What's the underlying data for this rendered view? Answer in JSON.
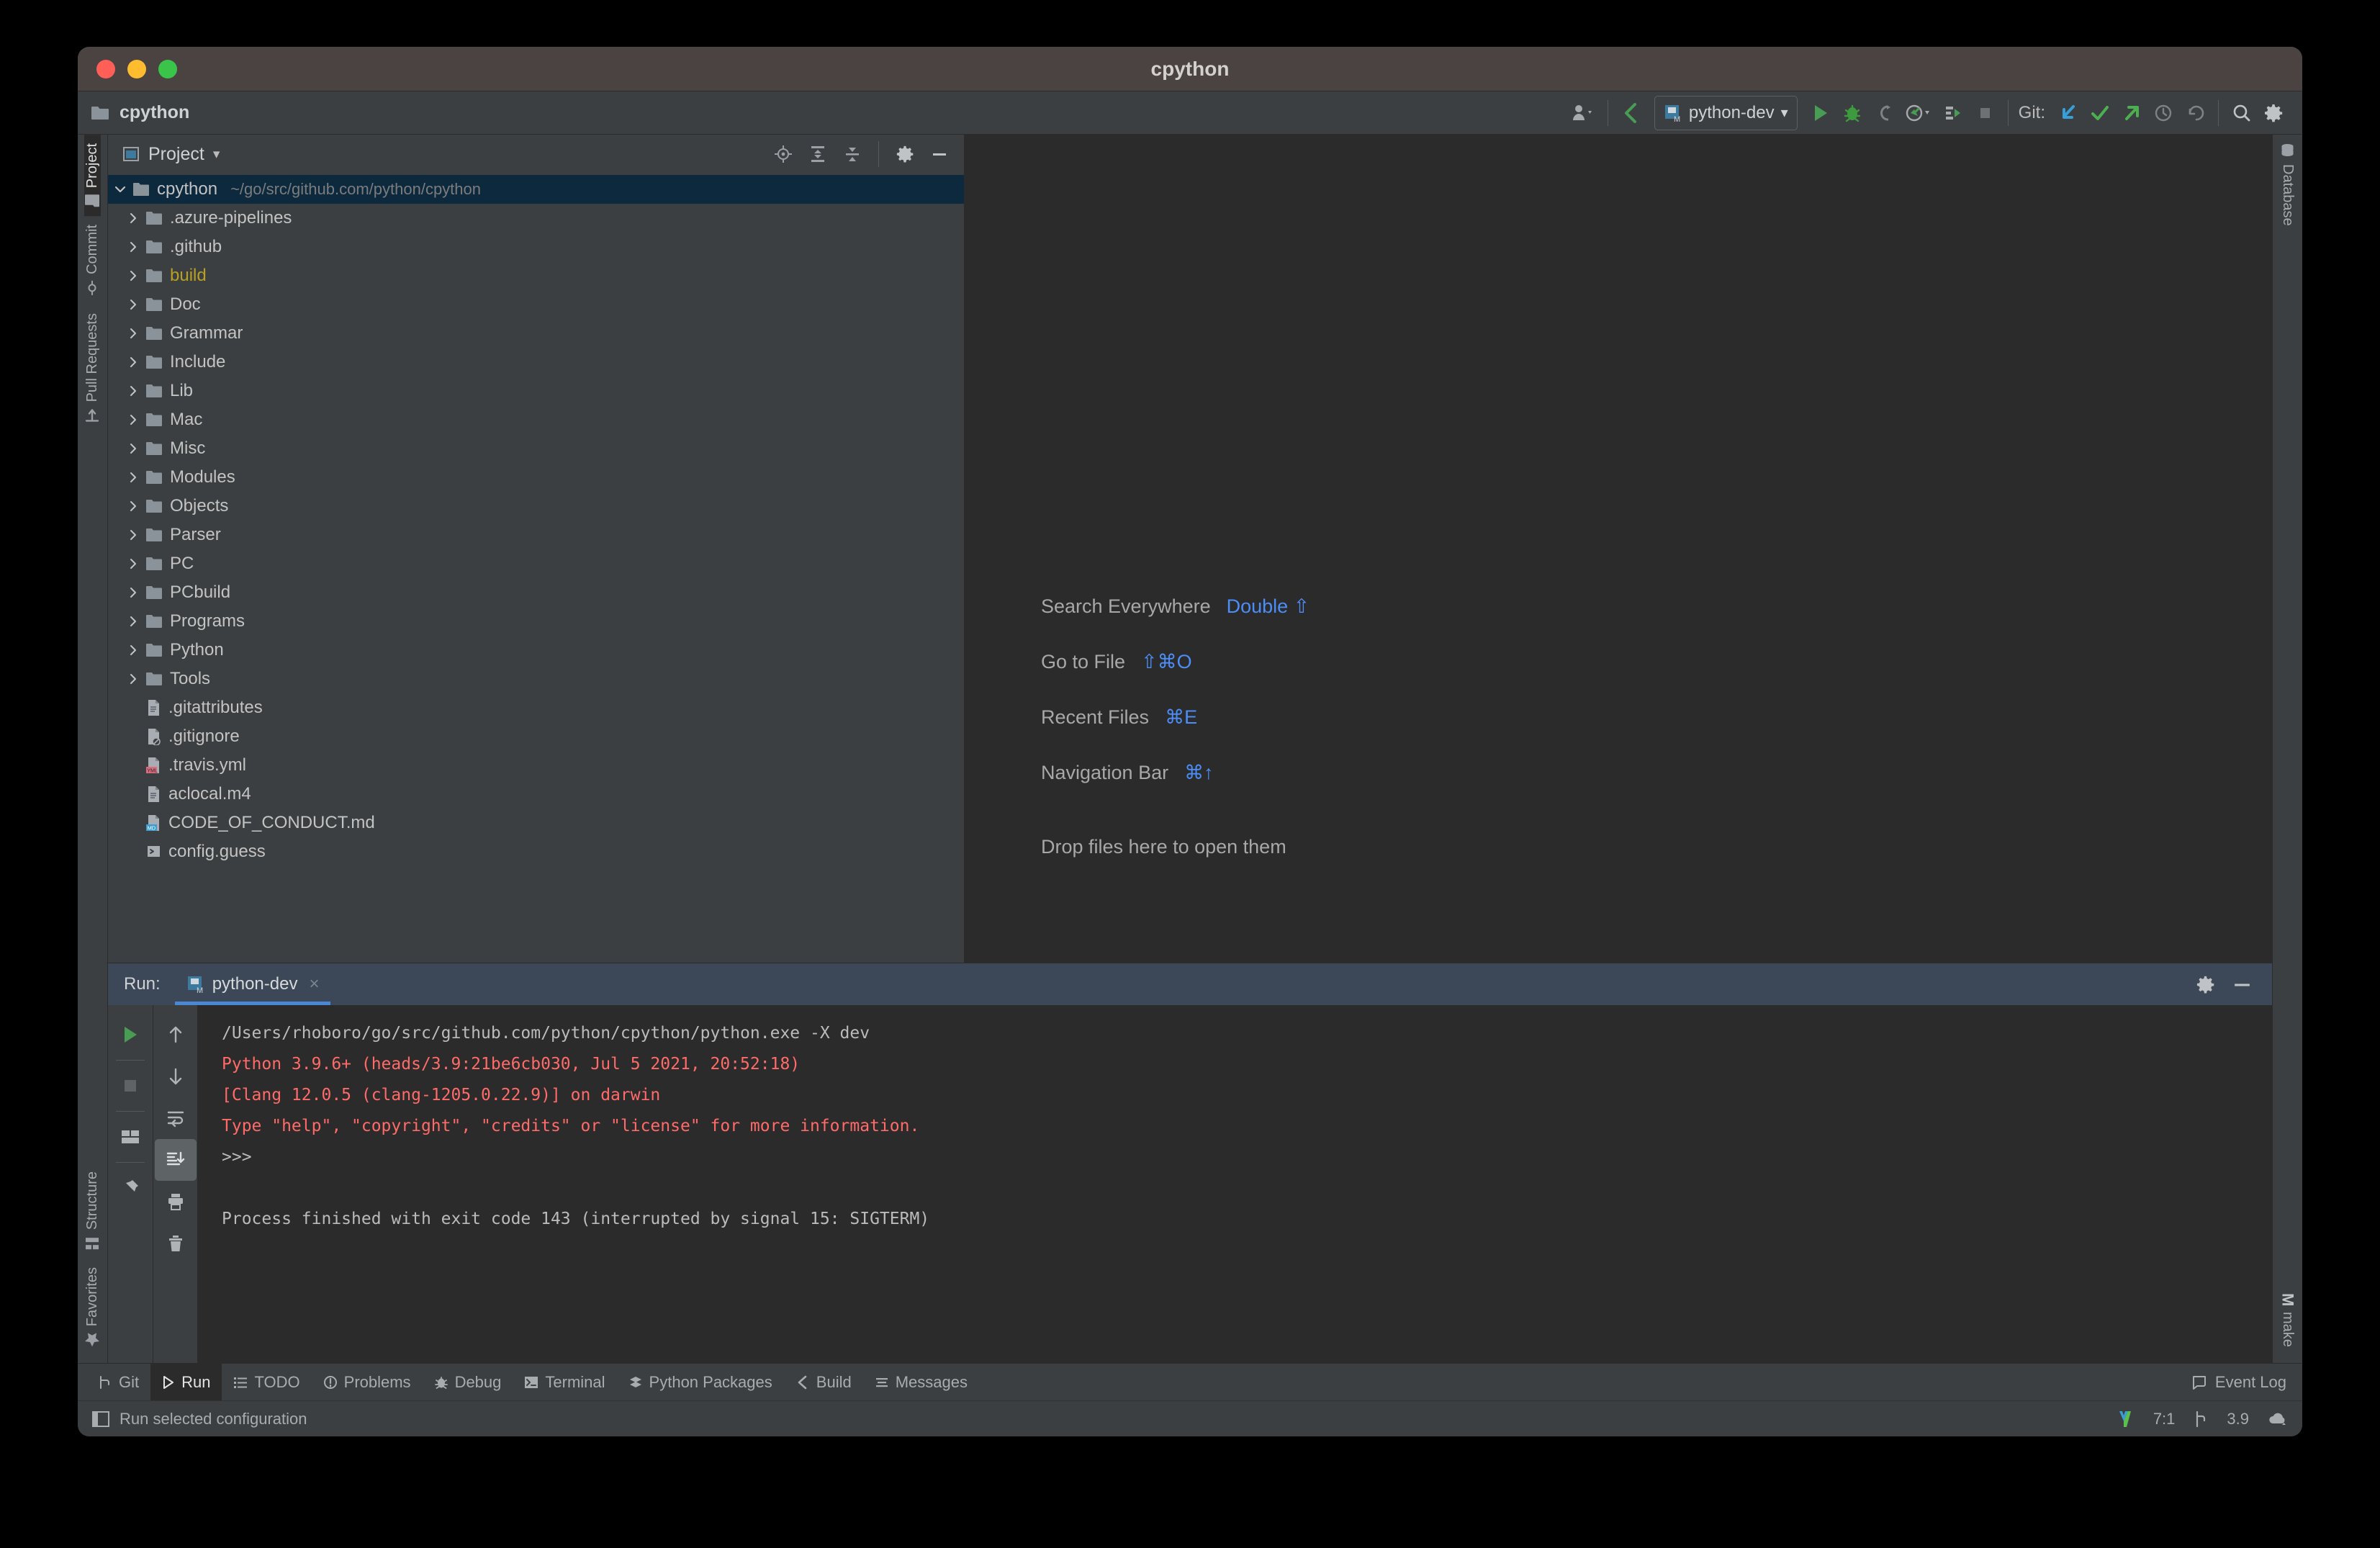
{
  "window": {
    "title": "cpython",
    "traffic_lights": [
      "close-red",
      "minimize-yellow",
      "zoom-green"
    ]
  },
  "projectbar": {
    "project_name": "cpython",
    "folder_icon": "folder-icon",
    "run_config": {
      "label": "python-dev",
      "icon": "python-module-icon",
      "chevron": "▾"
    },
    "git_label": "Git:",
    "buttons": [
      {
        "name": "user-avatar-dropdown",
        "icon": "person-icon"
      },
      {
        "name": "back-arrow",
        "icon": "chevron-left-icon"
      },
      {
        "name": "run-button",
        "icon": "play-icon"
      },
      {
        "name": "debug-button",
        "icon": "bug-icon"
      },
      {
        "name": "run-with-coverage",
        "icon": "coverage-icon"
      },
      {
        "name": "profile-button",
        "icon": "profile-icon"
      },
      {
        "name": "attach-debugger",
        "icon": "attach-icon"
      },
      {
        "name": "stop-button",
        "icon": "stop-icon"
      },
      {
        "name": "git-update",
        "icon": "arrow-down-left-icon"
      },
      {
        "name": "git-commit",
        "icon": "check-icon"
      },
      {
        "name": "git-push",
        "icon": "arrow-up-right-icon"
      },
      {
        "name": "git-history",
        "icon": "clock-icon"
      },
      {
        "name": "git-rollback",
        "icon": "undo-icon"
      },
      {
        "name": "search-everywhere",
        "icon": "search-icon"
      },
      {
        "name": "settings",
        "icon": "gear-icon"
      }
    ]
  },
  "left_rail": {
    "tabs": [
      {
        "label": "Project",
        "icon": "folder-icon",
        "active": true
      },
      {
        "label": "Commit",
        "icon": "commit-icon",
        "active": false
      },
      {
        "label": "Pull Requests",
        "icon": "pull-request-icon",
        "active": false
      }
    ],
    "bottom_tabs": [
      {
        "label": "Structure",
        "icon": "structure-icon"
      },
      {
        "label": "Favorites",
        "icon": "star-icon"
      }
    ]
  },
  "right_rail": {
    "tabs": [
      {
        "label": "Database",
        "icon": "database-icon"
      }
    ],
    "bottom_tabs": [
      {
        "label": "make",
        "icon": "make-m-icon"
      }
    ]
  },
  "project_panel": {
    "title": "Project",
    "title_icon": "project-view-icon",
    "chevron": "▾",
    "toolbar_icons": [
      {
        "name": "scroll-from-source-icon"
      },
      {
        "name": "expand-all-icon"
      },
      {
        "name": "collapse-all-icon"
      },
      {
        "name": "gear-icon"
      },
      {
        "name": "hide-icon"
      }
    ],
    "tree": [
      {
        "label": "cpython",
        "path": "~/go/src/github.com/python/cpython",
        "type": "folder",
        "expanded": true,
        "selected": true,
        "depth": 0
      },
      {
        "label": ".azure-pipelines",
        "type": "folder",
        "depth": 1
      },
      {
        "label": ".github",
        "type": "folder",
        "depth": 1
      },
      {
        "label": "build",
        "type": "folder",
        "depth": 1,
        "color": "#B8A022"
      },
      {
        "label": "Doc",
        "type": "folder",
        "depth": 1
      },
      {
        "label": "Grammar",
        "type": "folder",
        "depth": 1
      },
      {
        "label": "Include",
        "type": "folder",
        "depth": 1
      },
      {
        "label": "Lib",
        "type": "folder",
        "depth": 1
      },
      {
        "label": "Mac",
        "type": "folder",
        "depth": 1
      },
      {
        "label": "Misc",
        "type": "folder",
        "depth": 1
      },
      {
        "label": "Modules",
        "type": "folder",
        "depth": 1
      },
      {
        "label": "Objects",
        "type": "folder",
        "depth": 1
      },
      {
        "label": "Parser",
        "type": "folder",
        "depth": 1
      },
      {
        "label": "PC",
        "type": "folder",
        "depth": 1
      },
      {
        "label": "PCbuild",
        "type": "folder",
        "depth": 1
      },
      {
        "label": "Programs",
        "type": "folder",
        "depth": 1
      },
      {
        "label": "Python",
        "type": "folder",
        "depth": 1
      },
      {
        "label": "Tools",
        "type": "folder",
        "depth": 1
      },
      {
        "label": ".gitattributes",
        "type": "file-text",
        "depth": 1
      },
      {
        "label": ".gitignore",
        "type": "file-ignored",
        "depth": 1
      },
      {
        "label": ".travis.yml",
        "type": "file-yml",
        "depth": 1
      },
      {
        "label": "aclocal.m4",
        "type": "file-text",
        "depth": 1
      },
      {
        "label": "CODE_OF_CONDUCT.md",
        "type": "file-md",
        "depth": 1
      },
      {
        "label": "config.guess",
        "type": "file-script",
        "depth": 1
      }
    ]
  },
  "editor": {
    "hints": [
      {
        "label": "Search Everywhere",
        "shortcut": "Double ⇧"
      },
      {
        "label": "Go to File",
        "shortcut": "⇧⌘O"
      },
      {
        "label": "Recent Files",
        "shortcut": "⌘E"
      },
      {
        "label": "Navigation Bar",
        "shortcut": "⌘↑"
      }
    ],
    "drop_hint": "Drop files here to open them"
  },
  "run_window": {
    "label": "Run:",
    "tab": {
      "label": "python-dev",
      "icon": "python-module-icon",
      "close": "×"
    },
    "header_icons": [
      {
        "name": "gear-icon"
      },
      {
        "name": "hide-icon"
      }
    ],
    "gutter_left": [
      {
        "name": "rerun-button",
        "icon": "play-icon"
      },
      {
        "name": "stop-button",
        "icon": "stop-icon"
      },
      {
        "name": "layout-button",
        "icon": "layout-icon"
      },
      {
        "name": "pin-tab-button",
        "icon": "pin-icon"
      }
    ],
    "gutter_right": [
      {
        "name": "up-the-stack-button",
        "icon": "arrow-up-icon"
      },
      {
        "name": "down-the-stack-button",
        "icon": "arrow-down-icon"
      },
      {
        "name": "soft-wrap-button",
        "icon": "soft-wrap-icon"
      },
      {
        "name": "scroll-to-end-button",
        "icon": "scroll-to-end-icon",
        "active": true
      },
      {
        "name": "print-button",
        "icon": "printer-icon"
      },
      {
        "name": "clear-all-button",
        "icon": "trash-icon"
      }
    ],
    "console_lines": [
      {
        "text": "/Users/rhoboro/go/src/github.com/python/cpython/python.exe -X dev",
        "color": "white"
      },
      {
        "text": "Python 3.9.6+ (heads/3.9:21be6cb030, Jul  5 2021, 20:52:18)",
        "color": "red"
      },
      {
        "text": "[Clang 12.0.5 (clang-1205.0.22.9)] on darwin",
        "color": "red"
      },
      {
        "text": "Type \"help\", \"copyright\", \"credits\" or \"license\" for more information.",
        "color": "red"
      },
      {
        "text": ">>>",
        "color": "white"
      },
      {
        "text": "",
        "color": "white"
      },
      {
        "text": "Process finished with exit code 143 (interrupted by signal 15: SIGTERM)",
        "color": "white"
      }
    ]
  },
  "bottom_tabs": [
    {
      "label": "Git",
      "icon": "git-branch-icon",
      "active": false
    },
    {
      "label": "Run",
      "icon": "play-icon",
      "active": true
    },
    {
      "label": "TODO",
      "icon": "todo-icon",
      "active": false
    },
    {
      "label": "Problems",
      "icon": "problems-icon",
      "active": false
    },
    {
      "label": "Debug",
      "icon": "bug-icon",
      "active": false
    },
    {
      "label": "Terminal",
      "icon": "terminal-icon",
      "active": false
    },
    {
      "label": "Python Packages",
      "icon": "packages-icon",
      "active": false
    },
    {
      "label": "Build",
      "icon": "build-icon",
      "active": false
    },
    {
      "label": "Messages",
      "icon": "messages-icon",
      "active": false
    }
  ],
  "event_log": {
    "label": "Event Log",
    "icon": "balloon-icon"
  },
  "statusbar": {
    "message": "Run selected configuration",
    "left_icon": "toggle-toolwindows-icon",
    "caret_position": "7:1",
    "branch": "3.9",
    "branch_icon": "git-branch-icon",
    "interpreter_icon": "python-logo-icon",
    "cloud_icon": "cloud-icon"
  },
  "colors": {
    "titlebar": "#4A4342",
    "chrome": "#3C3F41",
    "editor_bg": "#2B2B2B",
    "selection": "#0D293E",
    "run_header": "#3C4757",
    "accent_blue": "#4C8EF7",
    "tab_underline": "#4A88D6",
    "console_red": "#FF6B68",
    "folder_yellow": "#B8A022",
    "green": "#499C54"
  }
}
